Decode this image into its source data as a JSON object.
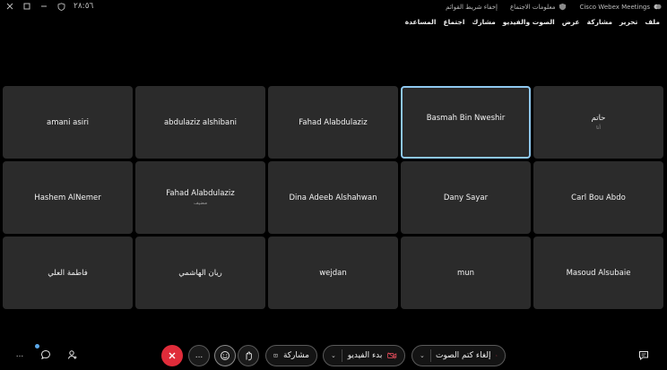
{
  "titlebar": {
    "time": "٢٨:٥٦",
    "app_name": "Cisco Webex Meetings",
    "meeting_info": "معلومات الاجتماع",
    "hide_menu_bar": "إخفاء شريط القوائم"
  },
  "menu": [
    "ملف",
    "تحرير",
    "مشاركة",
    "عرض",
    "الصوت والفيديو",
    "مشارك",
    "اجتماع",
    "المساعدة"
  ],
  "participants": [
    {
      "name": "amani asiri",
      "sub": ""
    },
    {
      "name": "abdulaziz alshibani",
      "sub": ""
    },
    {
      "name": "Fahad Alabdulaziz",
      "sub": ""
    },
    {
      "name": "Basmah Bin Nweshir",
      "sub": "",
      "active": true
    },
    {
      "name": "حاتم",
      "sub": "أنا"
    },
    {
      "name": "Hashem AlNemer",
      "sub": ""
    },
    {
      "name": "Fahad Alabdulaziz",
      "sub": "مضيف"
    },
    {
      "name": "Dina Adeeb Alshahwan",
      "sub": ""
    },
    {
      "name": "Dany Sayar",
      "sub": ""
    },
    {
      "name": "Carl Bou Abdo",
      "sub": ""
    },
    {
      "name": "فاطمة العلي",
      "sub": ""
    },
    {
      "name": "ريان الهاشمي",
      "sub": ""
    },
    {
      "name": "wejdan",
      "sub": ""
    },
    {
      "name": "mun",
      "sub": ""
    },
    {
      "name": "Masoud Alsubaie",
      "sub": ""
    }
  ],
  "toolbar": {
    "share_label": "مشاركة",
    "video_label": "بدء الفيديو",
    "audio_label": "إلغاء كتم الصوت",
    "more_label": "...",
    "end_color": "#e02c3a"
  },
  "colors": {
    "background": "#000000",
    "tile": "#2b2b2b",
    "active_border": "#8ec7ef",
    "muted_icon": "#e04b5a"
  }
}
